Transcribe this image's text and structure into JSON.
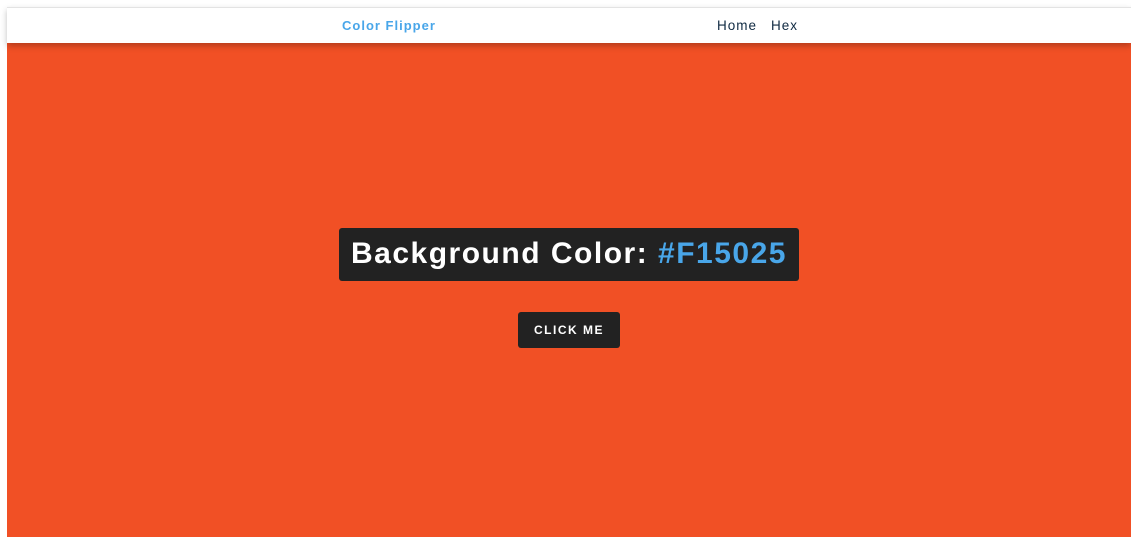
{
  "navbar": {
    "brand": "Color Flipper",
    "links": [
      {
        "label": "Home"
      },
      {
        "label": "Hex"
      }
    ]
  },
  "main": {
    "background_color": "#F15025",
    "label_prefix": "Background Color:",
    "color_value": "#F15025",
    "button_label": "click me"
  },
  "colors": {
    "accent": "#49a6e9",
    "panel": "#222222",
    "nav_text": "#102a42",
    "page": "#ffffff"
  }
}
